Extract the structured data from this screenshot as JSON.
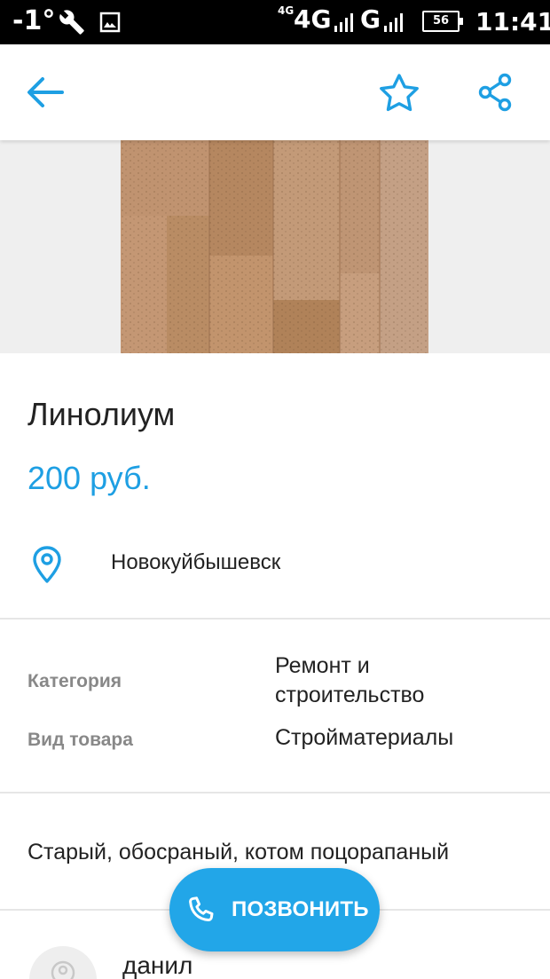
{
  "status_bar": {
    "temperature": "-1°",
    "network_small": "4G",
    "network_1": "4G",
    "network_2": "G",
    "battery": "56",
    "time": "11:41"
  },
  "toolbar": {
    "back_icon": "arrow-left-icon",
    "favorite_icon": "star-outline-icon",
    "share_icon": "share-icon"
  },
  "listing": {
    "title": "Линолиум",
    "price": "200 руб.",
    "location": "Новокуйбышевск",
    "properties": [
      {
        "label": "Категория",
        "value": "Ремонт и строительство"
      },
      {
        "label": "Вид товара",
        "value": "Стройматериалы"
      }
    ],
    "description": "Старый, обосраный, котом поцорапаный"
  },
  "seller": {
    "name": "данил"
  },
  "call_button": {
    "label": "ПОЗВОНИТЬ",
    "icon": "phone-icon"
  },
  "colors": {
    "accent": "#1e9fe3",
    "button": "#22a6e8",
    "label_gray": "#888888",
    "divider": "#e6e6e6"
  }
}
